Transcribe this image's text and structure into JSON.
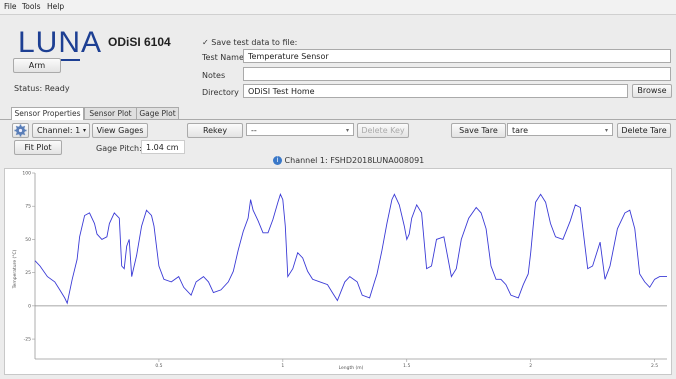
{
  "menu": [
    "File",
    "Tools",
    "Help"
  ],
  "logo": {
    "text": "LUNA",
    "model": "ODiSI 6104"
  },
  "arm_button": "Arm",
  "status": "Status: Ready",
  "save_panel": {
    "checkbox_label": "Save test data to file:",
    "checked": true,
    "test_name_label": "Test Name",
    "test_name_value": "Temperature Sensor",
    "notes_label": "Notes",
    "notes_value": "",
    "directory_label": "Directory",
    "directory_value": "ODiSI Test Home",
    "browse_button": "Browse"
  },
  "tabs": [
    {
      "label": "Sensor Properties",
      "active": true
    },
    {
      "label": "Sensor Plot",
      "active": false
    },
    {
      "label": "Gage Plot",
      "active": false
    }
  ],
  "toolbar": {
    "settings_icon": "gear-icon",
    "channel_select": "Channel: 1",
    "view_gages": "View Gages",
    "rekey": "Rekey",
    "key_select": "--",
    "delete_key": "Delete Key",
    "save_tare": "Save Tare",
    "tare_select": "tare",
    "delete_tare": "Delete Tare",
    "fit_plot": "Fit Plot",
    "gage_pitch_label": "Gage Pitch:",
    "gage_pitch_value": "1.04 cm"
  },
  "channel_info": {
    "icon": "info-icon",
    "text": "Channel 1: FSHD2018LUNA008091"
  },
  "colors": {
    "accent": "#1d3f93",
    "series": "#3b3bd6",
    "zero_line": "#888888"
  },
  "chart_data": {
    "type": "line",
    "title": "",
    "xlabel": "Length (m)",
    "ylabel": "Temperature (°C)",
    "xlim": [
      0.0,
      2.55
    ],
    "ylim": [
      -40,
      100
    ],
    "xticks": [
      0.5,
      1,
      1.5,
      2,
      2.5
    ],
    "yticks": [
      100,
      75,
      50,
      25,
      0,
      -25
    ],
    "grid": false,
    "series": [
      {
        "x": [
          0.0,
          0.02,
          0.05,
          0.08,
          0.1,
          0.12,
          0.13,
          0.15,
          0.17,
          0.18,
          0.2,
          0.22,
          0.24,
          0.25,
          0.27,
          0.29,
          0.3,
          0.32,
          0.34,
          0.35,
          0.36,
          0.37,
          0.38,
          0.39,
          0.41,
          0.43,
          0.45,
          0.47,
          0.48,
          0.5,
          0.52,
          0.55,
          0.58,
          0.6,
          0.63,
          0.65,
          0.68,
          0.7,
          0.72,
          0.75,
          0.78,
          0.8,
          0.82,
          0.84,
          0.86,
          0.87,
          0.88,
          0.9,
          0.92,
          0.94,
          0.96,
          0.98,
          0.99,
          1.0,
          1.01,
          1.02,
          1.04,
          1.06,
          1.08,
          1.1,
          1.12,
          1.15,
          1.18,
          1.2,
          1.22,
          1.25,
          1.27,
          1.3,
          1.32,
          1.35,
          1.37,
          1.38,
          1.4,
          1.42,
          1.44,
          1.45,
          1.47,
          1.49,
          1.5,
          1.51,
          1.52,
          1.54,
          1.56,
          1.58,
          1.6,
          1.62,
          1.65,
          1.68,
          1.7,
          1.72,
          1.75,
          1.78,
          1.8,
          1.82,
          1.84,
          1.86,
          1.88,
          1.89,
          1.9,
          1.92,
          1.95,
          1.97,
          1.99,
          2.0,
          2.01,
          2.02,
          2.04,
          2.06,
          2.08,
          2.1,
          2.13,
          2.16,
          2.18,
          2.2,
          2.23,
          2.25,
          2.28,
          2.3,
          2.32,
          2.35,
          2.38,
          2.4,
          2.42,
          2.44,
          2.46,
          2.48,
          2.5,
          2.52,
          2.55
        ],
        "y": [
          34,
          30,
          22,
          18,
          12,
          6,
          2,
          20,
          35,
          52,
          68,
          70,
          62,
          54,
          50,
          52,
          62,
          70,
          66,
          30,
          28,
          45,
          50,
          22,
          38,
          60,
          72,
          68,
          60,
          30,
          20,
          18,
          22,
          14,
          8,
          18,
          22,
          18,
          10,
          12,
          18,
          26,
          42,
          56,
          66,
          80,
          72,
          64,
          55,
          55,
          65,
          78,
          84,
          80,
          60,
          22,
          28,
          40,
          36,
          26,
          20,
          18,
          16,
          10,
          4,
          18,
          22,
          18,
          8,
          6,
          18,
          24,
          42,
          62,
          80,
          84,
          76,
          60,
          50,
          54,
          66,
          76,
          70,
          28,
          30,
          50,
          52,
          22,
          28,
          50,
          66,
          74,
          70,
          58,
          30,
          20,
          20,
          18,
          16,
          8,
          6,
          16,
          24,
          40,
          60,
          78,
          84,
          78,
          62,
          52,
          50,
          64,
          76,
          74,
          28,
          30,
          48,
          20,
          30,
          58,
          70,
          72,
          58,
          24,
          18,
          14,
          20,
          22,
          22
        ]
      }
    ]
  }
}
